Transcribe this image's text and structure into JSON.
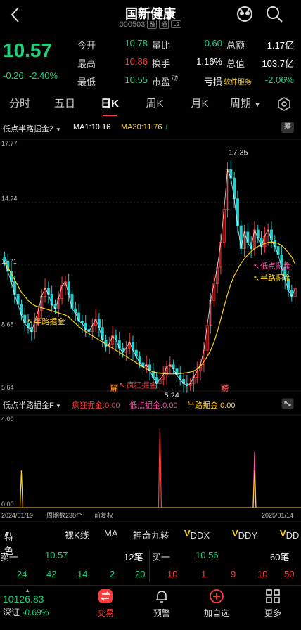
{
  "header": {
    "title": "国新健康",
    "code": "000503",
    "code_tags": [
      "融",
      "通",
      "L2"
    ]
  },
  "quote": {
    "price": "10.57",
    "change": "-0.26",
    "change_pct": "-2.40%",
    "rows": [
      {
        "l1": "今开",
        "v1": "10.78",
        "c1": "down",
        "l2": "量比",
        "v2": "0.60",
        "c2": "down",
        "l3": "总额",
        "v3": "1.17亿",
        "c3": "white"
      },
      {
        "l1": "最高",
        "v1": "10.86",
        "c1": "up",
        "l2": "换手",
        "v2": "1.16%",
        "c2": "white",
        "l3": "总值",
        "v3": "103.7亿",
        "c3": "white"
      },
      {
        "l1": "最低",
        "v1": "10.55",
        "c1": "down",
        "l2": "市盈",
        "l2_sup": "动",
        "v2": "亏损",
        "c2": "white",
        "l3": "软件服务",
        "v3": "-2.06%",
        "c3": "down"
      }
    ]
  },
  "tabs": [
    "分时",
    "五日",
    "日K",
    "周K",
    "月K",
    "周期"
  ],
  "active_tab": "日K",
  "main_chart": {
    "indicator_name": "低点半路掘金Z",
    "ma1_label": "MA1:",
    "ma1_value": "10.16",
    "ma30_label": "MA30:",
    "ma30_value": "11.76",
    "fuquan_label": "筹",
    "y_ticks": [
      "17.77",
      "14.74",
      "11.71",
      "8.68",
      "5.64"
    ],
    "high_label": "17.35",
    "low_label": "5.24",
    "signals": {
      "bz1": "半路掘金",
      "crazy": "疯狂掘金",
      "dd": "低点掘金",
      "bz2": "半路掘金"
    },
    "tags": {
      "jie": "解",
      "bang": "榜"
    }
  },
  "sub_chart": {
    "indicator_name": "低点半路掘金F",
    "crazy_label": "疯狂掘金:",
    "crazy_value": "0.00",
    "dd_label": "低点掘金:",
    "dd_value": "0.00",
    "bz_label": "半路掘金:",
    "bz_value": "0.00",
    "y_top": "4.00",
    "y_bottom": "0.00",
    "date_start": "2024/01/19",
    "period_count": "周期数238个",
    "fuquan": "前复权",
    "date_end": "2025/01/14"
  },
  "indicator_bar": {
    "special": "特色",
    "items": [
      "裸K线",
      "MA",
      "神奇九转",
      "DDX",
      "DDY",
      "DD"
    ]
  },
  "order_book": {
    "sell_label": "卖一",
    "sell_price": "10.57",
    "sell_count": "12笔",
    "buy_label": "买一",
    "buy_price": "10.56",
    "buy_count": "60笔",
    "sell_queue": [
      "24",
      "42",
      "14",
      "2",
      "20"
    ],
    "buy_queue": [
      "10",
      "1",
      "9",
      "10",
      "50"
    ]
  },
  "index": {
    "value": "10126.83",
    "name": "深证",
    "change_pct": "-0.69%"
  },
  "nav": [
    {
      "label": "交易",
      "icon": "trade-icon"
    },
    {
      "label": "预警",
      "icon": "bell-icon"
    },
    {
      "label": "加自选",
      "icon": "add-icon"
    },
    {
      "label": "更多",
      "icon": "grid-icon"
    }
  ],
  "colors": {
    "up": "#ff3b3b",
    "down": "#22d07a",
    "ma1": "#ffffff",
    "ma30": "#ffd11a",
    "accent": "#ff3b3b"
  },
  "chart_data": {
    "type": "candlestick",
    "x_start": "2024/01/19",
    "x_end": "2025/01/14",
    "ylim": [
      5.64,
      17.77
    ],
    "close": [
      11.9,
      11.4,
      10.9,
      10.3,
      9.8,
      9.3,
      8.9,
      8.7,
      8.5,
      9.0,
      9.5,
      10.2,
      10.6,
      10.3,
      9.8,
      9.6,
      10.1,
      10.7,
      10.9,
      10.3,
      9.6,
      9.4,
      9.0,
      8.9,
      8.6,
      8.5,
      8.8,
      9.1,
      8.7,
      8.1,
      7.8,
      7.9,
      8.3,
      8.1,
      7.7,
      7.5,
      7.7,
      8.0,
      7.6,
      7.3,
      7.0,
      6.8,
      6.9,
      6.6,
      6.3,
      6.0,
      6.2,
      6.4,
      6.8,
      6.9,
      6.7,
      6.4,
      6.2,
      6.0,
      5.9,
      6.0,
      6.3,
      6.6,
      6.9,
      7.6,
      8.8,
      10.0,
      10.8,
      11.6,
      12.8,
      14.4,
      16.3,
      15.9,
      14.9,
      13.6,
      12.5,
      13.3,
      12.8,
      12.5,
      13.4,
      13.0,
      12.6,
      13.1,
      13.4,
      12.9,
      12.6,
      12.2,
      11.6,
      11.0,
      10.5,
      10.2,
      10.57
    ],
    "ma30": [
      11.8,
      11.6,
      11.3,
      11.0,
      10.7,
      10.4,
      10.2,
      10.0,
      9.85,
      9.75,
      9.7,
      9.65,
      9.6,
      9.55,
      9.5,
      9.45,
      9.4,
      9.35,
      9.3,
      9.2,
      9.05,
      8.9,
      8.75,
      8.6,
      8.5,
      8.4,
      8.3,
      8.2,
      8.1,
      8.0,
      7.9,
      7.8,
      7.7,
      7.6,
      7.5,
      7.4,
      7.3,
      7.2,
      7.1,
      7.0,
      6.9,
      6.8,
      6.7,
      6.62,
      6.56,
      6.52,
      6.5,
      6.48,
      6.47,
      6.46,
      6.46,
      6.47,
      6.48,
      6.5,
      6.52,
      6.55,
      6.6,
      6.7,
      6.85,
      7.05,
      7.3,
      7.6,
      8.0,
      8.5,
      9.1,
      9.7,
      10.3,
      10.8,
      11.2,
      11.5,
      11.8,
      12.0,
      12.2,
      12.35,
      12.5,
      12.6,
      12.68,
      12.74,
      12.8,
      12.82,
      12.8,
      12.75,
      12.65,
      12.5,
      12.3,
      12.1,
      11.76
    ],
    "sub_signals": [
      {
        "series": "半路掘金",
        "index": 5,
        "value": 1.6,
        "color": "#ffd11a"
      },
      {
        "series": "疯狂掘金",
        "index": 46,
        "value": 3.4,
        "color": "#ff3b3b"
      },
      {
        "series": "低点掘金",
        "index": 74,
        "value": 2.4,
        "color": "#ff4fa8"
      },
      {
        "series": "半路掘金",
        "index": 74,
        "value": 1.6,
        "color": "#ffd11a"
      }
    ],
    "sub_ylim": [
      0,
      4
    ]
  }
}
